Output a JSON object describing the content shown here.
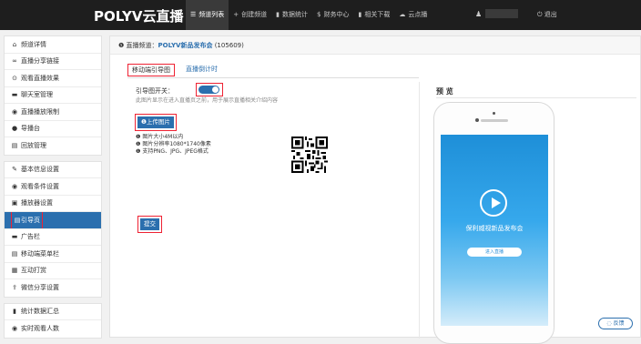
{
  "brand": {
    "logo": "POLYV云直播"
  },
  "nav": {
    "items": [
      {
        "icon": "☰",
        "label": "频道列表"
      },
      {
        "icon": "+",
        "label": "创建频道"
      },
      {
        "icon": "▮",
        "label": "数据统计"
      },
      {
        "icon": "$",
        "label": "财务中心"
      },
      {
        "icon": "▮",
        "label": "相关下载"
      },
      {
        "icon": "☁",
        "label": "云点播"
      }
    ],
    "logout": "退出"
  },
  "sidebar": {
    "group1": [
      {
        "icon": "⌂",
        "label": "频道详情"
      },
      {
        "icon": "🔗",
        "label": "直播分享链接"
      },
      {
        "icon": "⊙",
        "label": "观看直播效果"
      },
      {
        "icon": "▬",
        "label": "聊天室管理"
      },
      {
        "icon": "◉",
        "label": "直播播放限制"
      },
      {
        "icon": "●",
        "label": "导播台"
      },
      {
        "icon": "▤",
        "label": "回放管理"
      }
    ],
    "group2": [
      {
        "icon": "✎",
        "label": "基本信息设置"
      },
      {
        "icon": "◉",
        "label": "观看条件设置"
      },
      {
        "icon": "▣",
        "label": "播放器设置"
      },
      {
        "icon": "▤",
        "label": "引导页"
      },
      {
        "icon": "▬",
        "label": "广告栏"
      },
      {
        "icon": "▤",
        "label": "移动端菜单栏"
      },
      {
        "icon": "▦",
        "label": "互动打赏"
      },
      {
        "icon": "⇪",
        "label": "微信分享设置"
      }
    ],
    "group3": [
      {
        "icon": "▮",
        "label": "统计数据汇总"
      },
      {
        "icon": "◉",
        "label": "实时观看人数"
      }
    ]
  },
  "breadcrumb": {
    "prefix": "直播频道：",
    "channel": "POLYV新品发布会",
    "id": "(105609)"
  },
  "tabs": [
    {
      "label": "移动端引导图"
    },
    {
      "label": "直播倒计时"
    }
  ],
  "guide": {
    "switch_label": "引导图开关：",
    "hint": "此图片显示在进入直播页之前，用于展示直播相关介绍内容",
    "upload_label": "上传图片",
    "notes": [
      "图片大小4M以内",
      "图片分辨率1080*1740像素",
      "支持PNG、JPG、JPEG格式"
    ],
    "submit_label": "提交"
  },
  "preview": {
    "title": "预 览",
    "event_title": "保利威视新品发布会",
    "enter_button": "进入直播"
  },
  "feedback": {
    "label": "反馈"
  },
  "colors": {
    "accent": "#2b6fae",
    "highlight": "#e23333",
    "topbar": "#1e1e1e"
  }
}
